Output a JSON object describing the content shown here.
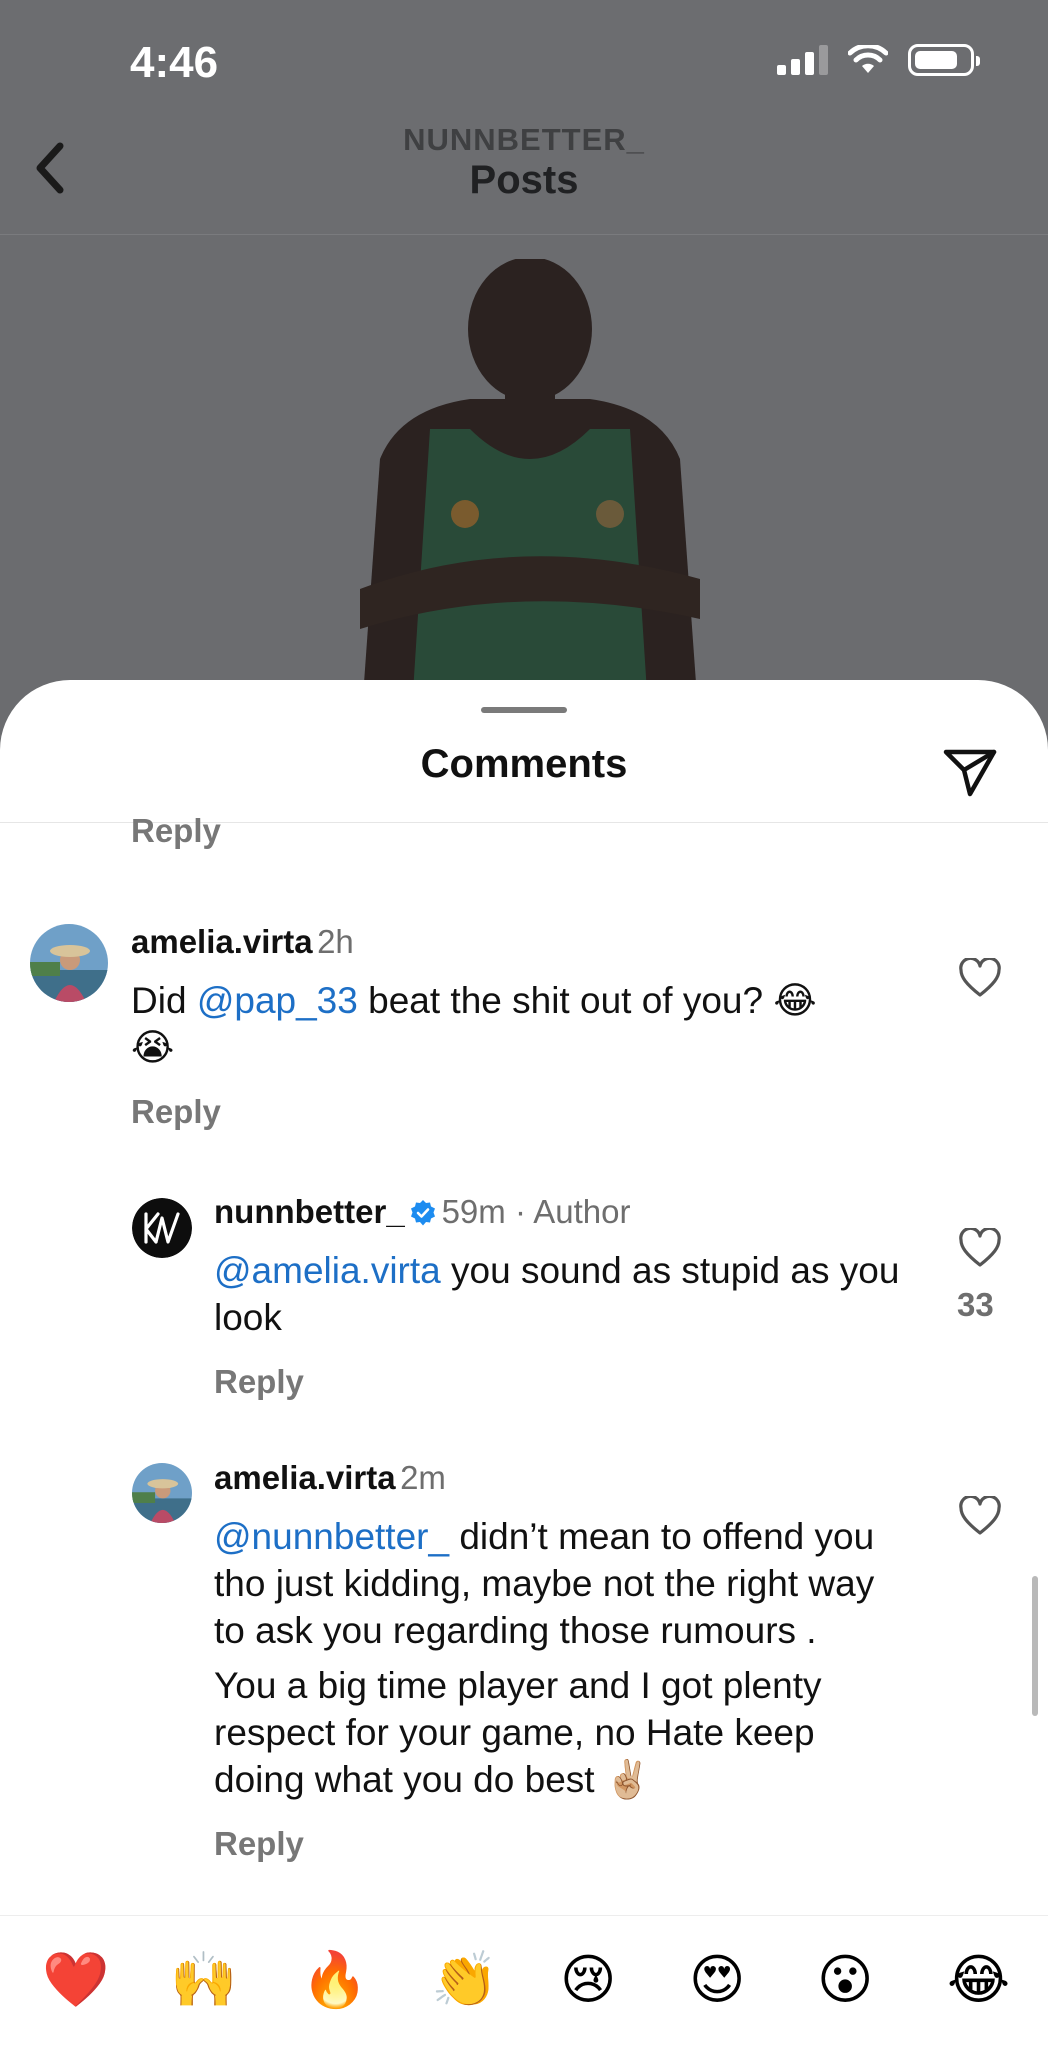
{
  "status_bar": {
    "time": "4:46"
  },
  "header": {
    "subtitle": "NUNNBETTER_",
    "title": "Posts"
  },
  "sheet": {
    "title": "Comments"
  },
  "comments": [
    {
      "reply_label": "Reply"
    },
    {
      "username": "amelia.virta",
      "time": "2h",
      "mention": "@pap_33",
      "text_after_mention": " beat the shit out of you?",
      "text_before_mention": "Did ",
      "emojis_inline": "😂",
      "emojis_line2": "😭",
      "reply_label": "Reply"
    },
    {
      "username": "nunnbetter_",
      "time": "59m · Author",
      "mention": "@amelia.virta",
      "text_after_mention": " you sound as stupid as you look",
      "likes": "33",
      "reply_label": "Reply"
    },
    {
      "username": "amelia.virta",
      "time": "2m",
      "mention": "@nunnbetter_",
      "text_after_mention": " didn’t mean to offend you tho just kidding, maybe not the right way to ask you regarding those rumours .",
      "paragraph2": "You a big time player and I got plenty respect for your game, no Hate keep doing what you do best",
      "paragraph2_emoji": "✌🏼",
      "reply_label": "Reply"
    }
  ],
  "emoji_bar": [
    "❤️",
    "🙌",
    "🔥",
    "👏",
    "😢",
    "😍",
    "😮",
    "😂"
  ],
  "colors": {
    "mention": "#1d6fc6",
    "verified": "#1d8cf0",
    "dim_overlay": "#6c6d70"
  }
}
